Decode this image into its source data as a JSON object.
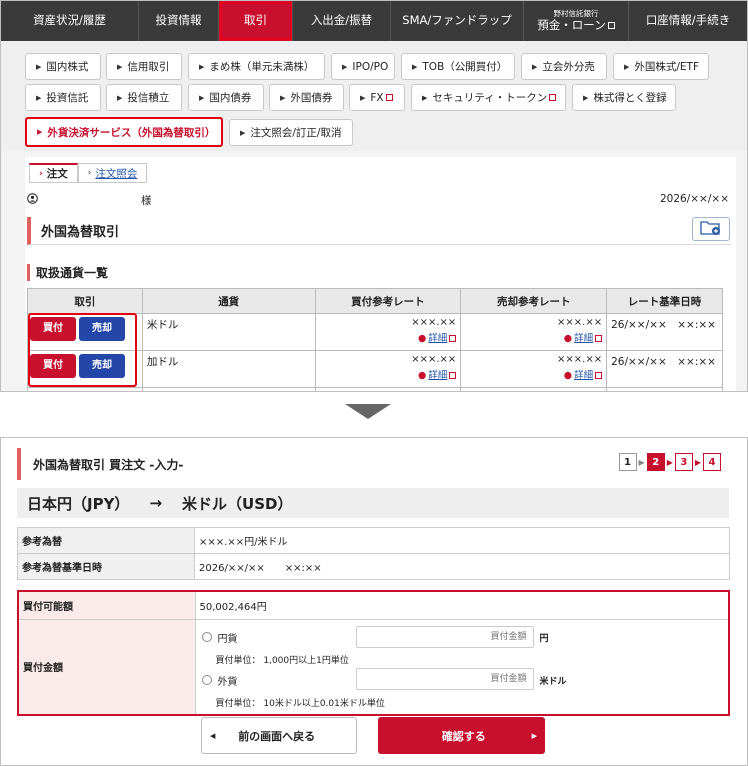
{
  "navbar": {
    "items": [
      {
        "label": "資産状況/履歴"
      },
      {
        "label": "投資情報"
      },
      {
        "label": "取引"
      },
      {
        "label": "入出金/振替"
      },
      {
        "label": "SMA/ファンドラップ"
      },
      {
        "label_small": "野村信託銀行",
        "label": "預金・ローン"
      },
      {
        "label": "口座情報/手続き"
      }
    ]
  },
  "subnav": {
    "items": [
      "国内株式",
      "信用取引",
      "まめ株（単元未満株）",
      "IPO/PO",
      "TOB（公開買付）",
      "立会外分売",
      "外国株式/ETF",
      "投資信託",
      "投信積立",
      "国内債券",
      "外国債券",
      "FX",
      "セキュリティ・トークン",
      "株式得とく登録",
      "外貨決済サービス（外国為替取引）",
      "注文照会/訂正/取消"
    ]
  },
  "top": {
    "tab_order": "注文",
    "tab_inquiry": "注文照会",
    "user_suffix": "様",
    "date": "2026/××/××",
    "page_title": "外国為替取引",
    "section_title": "取扱通貨一覧",
    "table": {
      "headers": [
        "取引",
        "通貨",
        "買付参考レート",
        "売却参考レート",
        "レート基準日時"
      ],
      "buy_label": "買付",
      "sell_label": "売却",
      "detail_label": "詳細",
      "rows": [
        {
          "currency": "米ドル",
          "buy_rate": "×××.××",
          "sell_rate": "×××.××",
          "datetime": "26/××/××　××:××"
        },
        {
          "currency": "加ドル",
          "buy_rate": "×××.××",
          "sell_rate": "×××.××",
          "datetime": "26/××/××　××:××"
        }
      ]
    }
  },
  "bottom": {
    "title": "外国為替取引 買注文 -入力-",
    "steps": [
      "1",
      "2",
      "3",
      "4"
    ],
    "pair_from": "日本円（JPY）",
    "pair_arrow": "→",
    "pair_to": "米ドル（USD）",
    "ref_rate_label": "参考為替",
    "ref_rate_value": "×××.××円/米ドル",
    "ref_date_label": "参考為替基準日時",
    "ref_date_value": "2026/××/××　　××:××",
    "available_label": "買付可能額",
    "available_value": "50,002,464円",
    "amount_label": "買付金額",
    "opt_yen": "円貨",
    "opt_foreign": "外貨",
    "amount_placeholder": "買付金額",
    "unit_yen": "円",
    "unit_usd": "米ドル",
    "note_yen": "買付単位： 1,000円以上1円単位",
    "note_usd": "買付単位： 10米ドル以上0.01米ドル単位",
    "back_button": "前の画面へ戻る",
    "confirm_button": "確認する"
  }
}
